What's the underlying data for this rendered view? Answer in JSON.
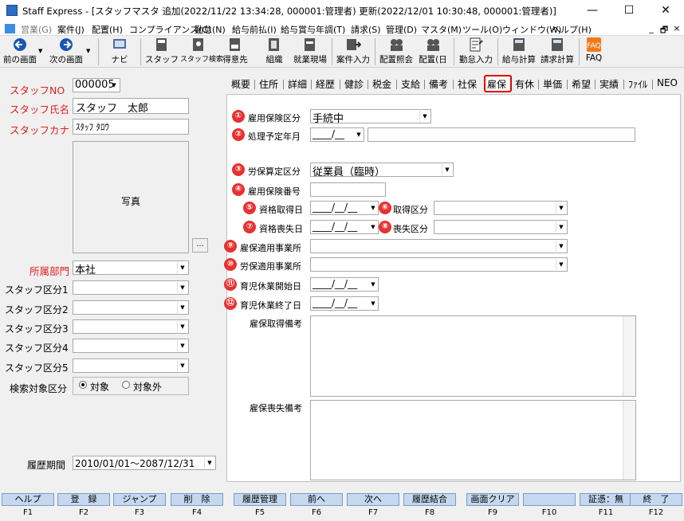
{
  "window": {
    "title": "Staff Express - [スタッフマスタ 追加(2022/11/22 13:34:28, 000001:管理者) 更新(2022/12/01 10:30:48, 000001:管理者)]",
    "minimize": "—",
    "maximize": "☐",
    "close": "✕"
  },
  "menu": {
    "items": [
      "営業(G)",
      "案件(J)",
      "配置(H)",
      "コンプライアンス(C)",
      "勤怠(N)",
      "給与前払(I)",
      "給与賞与年調(T)",
      "請求(S)",
      "管理(D)",
      "マスタ(M)",
      "ツール(O)",
      "ウィンドウ(W)",
      "ヘルプ(H)"
    ],
    "mdi_min": "_",
    "mdi_restore": "🗗",
    "mdi_close": "×"
  },
  "toolbar": {
    "items": [
      "前の画面",
      "次の画面",
      "ナビ",
      "スタッフ",
      "スタッフ検索",
      "得意先",
      "組織",
      "就業現場",
      "案件入力",
      "配置照会",
      "配置(日",
      "勤怠入力",
      "給与計算",
      "請求計算",
      "FAQ"
    ]
  },
  "left": {
    "staff_no_label": "スタッフNO",
    "staff_no_value": "000005",
    "staff_name_label": "スタッフ氏名",
    "staff_name_value": "スタッフ　太郎",
    "staff_kana_label": "スタッフカナ",
    "staff_kana_value": "ｽﾀｯﾌ ﾀﾛｳ",
    "photo_label": "写真",
    "photo_button": "...",
    "dept_label": "所属部門",
    "dept_value": "本社",
    "kubun1_label": "スタッフ区分1",
    "kubun2_label": "スタッフ区分2",
    "kubun3_label": "スタッフ区分3",
    "kubun4_label": "スタッフ区分4",
    "kubun5_label": "スタッフ区分5",
    "search_label": "検索対象区分",
    "radio_on": "対象",
    "radio_off": "対象外",
    "history_label": "履歴期間",
    "history_value": "2010/01/01～2087/12/31"
  },
  "tabs": [
    "概要",
    "住所",
    "詳細",
    "経歴",
    "健診",
    "税金",
    "支給",
    "備考",
    "社保",
    "雇保",
    "有休",
    "単価",
    "希望",
    "実績",
    "ﾌｧｲﾙ",
    "NEO"
  ],
  "active_tab": "雇保",
  "form": {
    "n1": "①",
    "f1_label": "雇用保険区分",
    "f1_value": "手続中",
    "n2": "②",
    "f2_label": "処理予定年月",
    "f2_value": "____/__",
    "n3": "③",
    "f3_label": "労保算定区分",
    "f3_value": "従業員（臨時）",
    "n4": "④",
    "f4_label": "雇用保険番号",
    "n5": "⑤",
    "f5_label": "資格取得日",
    "f5_value": "____/__/__",
    "n6": "⑥",
    "f6_label": "取得区分",
    "n7": "⑦",
    "f7_label": "資格喪失日",
    "f7_value": "____/__/__",
    "n8": "⑧",
    "f8_label": "喪失区分",
    "n9": "⑨",
    "f9_label": "雇保適用事業所",
    "n10": "⑩",
    "f10_label": "労保適用事業所",
    "n11": "⑪",
    "f11_label": "育児休業開始日",
    "f11_value": "____/__/__",
    "n12": "⑫",
    "f12_label": "育児休業終了日",
    "f12_value": "____/__/__",
    "memo1_label": "雇保取得備考",
    "memo2_label": "雇保喪失備考"
  },
  "fkeys": [
    {
      "label": "ヘルプ",
      "key": "F1"
    },
    {
      "label": "登　録",
      "key": "F2"
    },
    {
      "label": "ジャンプ",
      "key": "F3"
    },
    {
      "label": "削　除",
      "key": "F4"
    },
    {
      "label": "履歴管理",
      "key": "F5"
    },
    {
      "label": "前へ",
      "key": "F6"
    },
    {
      "label": "次へ",
      "key": "F7"
    },
    {
      "label": "履歴結合",
      "key": "F8"
    },
    {
      "label": "画面クリア",
      "key": "F9"
    },
    {
      "label": "",
      "key": "F10"
    },
    {
      "label": "証憑：無",
      "key": "F11"
    },
    {
      "label": "終　了",
      "key": "F12"
    }
  ]
}
